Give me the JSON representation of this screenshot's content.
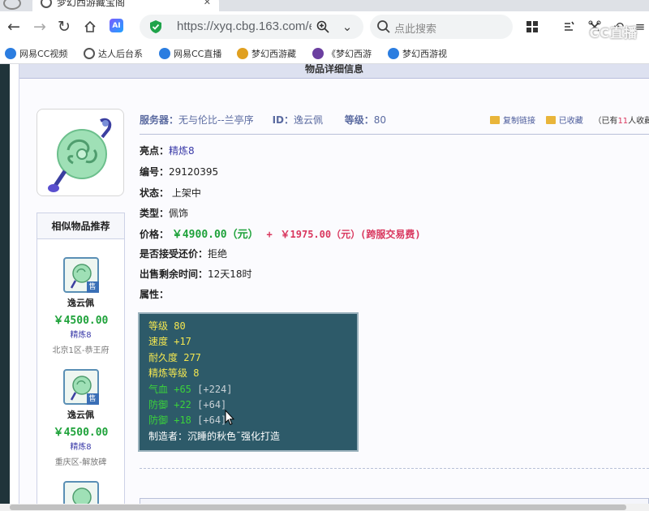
{
  "browser": {
    "tab_title": "梦幻西游藏宝阁",
    "url": "https://xyq.cbg.163.com/eq",
    "ai_label": "AI",
    "search_placeholder": "点此搜索"
  },
  "bookmarks": [
    {
      "label": "网易CC视频",
      "color": "#2b7de0"
    },
    {
      "label": "达人后台系",
      "color": "#555555"
    },
    {
      "label": "网易CC直播",
      "color": "#2b7de0"
    },
    {
      "label": "梦幻西游藏",
      "color": "#e0a020"
    },
    {
      "label": "《梦幻西游",
      "color": "#6b3fa0"
    },
    {
      "label": "梦幻西游视",
      "color": "#2b7de0"
    }
  ],
  "watermark": "CC直播",
  "page": {
    "header_title": "物品详细信息",
    "server_label": "服务器：",
    "server_value": "无与伦比--兰亭序",
    "id_label": "ID：",
    "id_value": "逸云佩",
    "level_label": "等级：",
    "level_value": "80",
    "copy_link": "复制链接",
    "favorited": "已收藏",
    "fav_prefix": "（已有",
    "fav_count": "11",
    "fav_suffix": "人收藏"
  },
  "fields": {
    "highlight_label": "亮点：",
    "highlight_value": "精炼8",
    "number_label": "编号：",
    "number_value": "29120395",
    "status_label": "状态：",
    "status_value": "上架中",
    "type_label": "类型：",
    "type_value": "佩饰",
    "price_label": "价格：",
    "price_value": "￥4900.00（元）",
    "plus": "+",
    "fee_value": "￥1975.00（元）(跨服交易费)",
    "counter_label": "是否接受还价：",
    "counter_value": "拒绝",
    "time_label": "出售剩余时间：",
    "time_value": "12天18时",
    "attr_label": "属性："
  },
  "attributes": {
    "level": "等级 80",
    "speed": "速度 +17",
    "durability": "耐久度 277",
    "refine": "精炼等级 8",
    "hp": "气血 +65",
    "hp_extra": "[+224]",
    "def1": "防御 +22",
    "def1_extra": "[+64]",
    "def2": "防御 +18",
    "def2_extra": "[+64]",
    "maker": "制造者：沉睡的秋色ˉ强化打造"
  },
  "similar": {
    "title": "相似物品推荐",
    "sold_tag": "售",
    "items": [
      {
        "name": "逸云佩",
        "price": "￥4500.00",
        "tag": "精炼8",
        "server": "北京1区-恭王府"
      },
      {
        "name": "逸云佩",
        "price": "￥4500.00",
        "tag": "精炼8",
        "server": "重庆区-解放碑"
      }
    ]
  },
  "colors": {
    "price_green": "#1ea23a",
    "fee_red": "#d9375e",
    "attr_bg": "#2d5a69",
    "link_blue": "#3a3aa8"
  }
}
